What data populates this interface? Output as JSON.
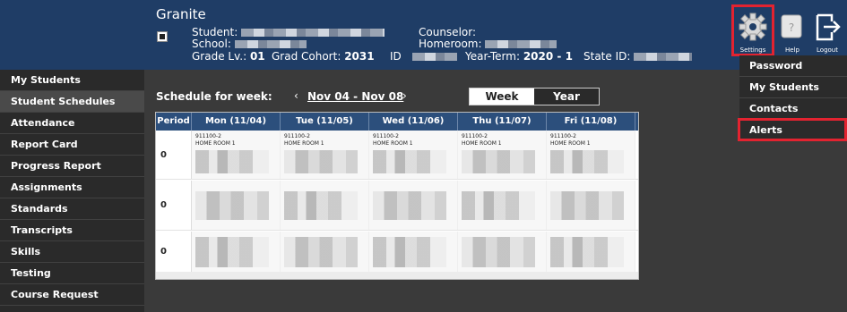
{
  "header": {
    "school_name": "Granite",
    "student_label": "Student:",
    "school_label": "School:",
    "grade_label": "Grade Lv.:",
    "grade_value": "01",
    "grad_cohort_label": "Grad Cohort:",
    "grad_cohort_value": "2031",
    "id_label": "ID",
    "counselor_label": "Counselor:",
    "homeroom_label": "Homeroom:",
    "year_term_label": "Year-Term:",
    "year_term_value": "2020 - 1",
    "state_id_label": "State ID:"
  },
  "top_icons": {
    "settings_label": "Settings",
    "help_label": "Help",
    "logout_label": "Logout"
  },
  "settings_menu": [
    "Password",
    "My Students",
    "Contacts",
    "Alerts"
  ],
  "sidebar": {
    "items": [
      {
        "label": "My Students",
        "active": false
      },
      {
        "label": "Student Schedules",
        "active": true
      },
      {
        "label": "Attendance",
        "active": false
      },
      {
        "label": "Report Card",
        "active": false
      },
      {
        "label": "Progress Report",
        "active": false
      },
      {
        "label": "Assignments",
        "active": false
      },
      {
        "label": "Standards",
        "active": false
      },
      {
        "label": "Transcripts",
        "active": false
      },
      {
        "label": "Skills",
        "active": false
      },
      {
        "label": "Testing",
        "active": false
      },
      {
        "label": "Course Request",
        "active": false
      }
    ]
  },
  "schedule": {
    "week_label": "Schedule for week:",
    "prev_arrow": "‹",
    "week_range": "Nov 04 - Nov 08",
    "next_arrow": "›",
    "toggle_week": "Week",
    "toggle_year": "Year",
    "columns": [
      "Period",
      "Mon (11/04)",
      "Tue (11/05)",
      "Wed (11/06)",
      "Thu (11/07)",
      "Fri (11/08)"
    ],
    "rows": [
      {
        "period": "0",
        "course_code": "911100-2",
        "course_name": "HOME ROOM 1"
      },
      {
        "period": "0",
        "course_code": "",
        "course_name": ""
      },
      {
        "period": "0",
        "course_code": "",
        "course_name": ""
      }
    ]
  },
  "colors": {
    "header_bg": "#1f3d66",
    "highlight_red": "#e32330",
    "table_header_bg": "#2c4f7c"
  }
}
